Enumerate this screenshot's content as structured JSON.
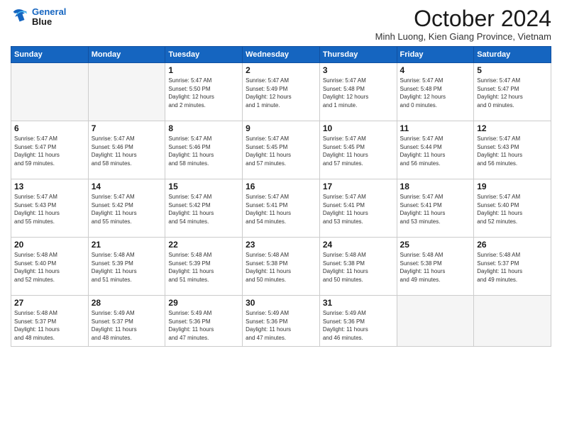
{
  "logo": {
    "line1": "General",
    "line2": "Blue"
  },
  "header": {
    "month": "October 2024",
    "location": "Minh Luong, Kien Giang Province, Vietnam"
  },
  "weekdays": [
    "Sunday",
    "Monday",
    "Tuesday",
    "Wednesday",
    "Thursday",
    "Friday",
    "Saturday"
  ],
  "weeks": [
    [
      {
        "day": "",
        "info": ""
      },
      {
        "day": "",
        "info": ""
      },
      {
        "day": "1",
        "info": "Sunrise: 5:47 AM\nSunset: 5:50 PM\nDaylight: 12 hours\nand 2 minutes."
      },
      {
        "day": "2",
        "info": "Sunrise: 5:47 AM\nSunset: 5:49 PM\nDaylight: 12 hours\nand 1 minute."
      },
      {
        "day": "3",
        "info": "Sunrise: 5:47 AM\nSunset: 5:48 PM\nDaylight: 12 hours\nand 1 minute."
      },
      {
        "day": "4",
        "info": "Sunrise: 5:47 AM\nSunset: 5:48 PM\nDaylight: 12 hours\nand 0 minutes."
      },
      {
        "day": "5",
        "info": "Sunrise: 5:47 AM\nSunset: 5:47 PM\nDaylight: 12 hours\nand 0 minutes."
      }
    ],
    [
      {
        "day": "6",
        "info": "Sunrise: 5:47 AM\nSunset: 5:47 PM\nDaylight: 11 hours\nand 59 minutes."
      },
      {
        "day": "7",
        "info": "Sunrise: 5:47 AM\nSunset: 5:46 PM\nDaylight: 11 hours\nand 58 minutes."
      },
      {
        "day": "8",
        "info": "Sunrise: 5:47 AM\nSunset: 5:46 PM\nDaylight: 11 hours\nand 58 minutes."
      },
      {
        "day": "9",
        "info": "Sunrise: 5:47 AM\nSunset: 5:45 PM\nDaylight: 11 hours\nand 57 minutes."
      },
      {
        "day": "10",
        "info": "Sunrise: 5:47 AM\nSunset: 5:45 PM\nDaylight: 11 hours\nand 57 minutes."
      },
      {
        "day": "11",
        "info": "Sunrise: 5:47 AM\nSunset: 5:44 PM\nDaylight: 11 hours\nand 56 minutes."
      },
      {
        "day": "12",
        "info": "Sunrise: 5:47 AM\nSunset: 5:43 PM\nDaylight: 11 hours\nand 56 minutes."
      }
    ],
    [
      {
        "day": "13",
        "info": "Sunrise: 5:47 AM\nSunset: 5:43 PM\nDaylight: 11 hours\nand 55 minutes."
      },
      {
        "day": "14",
        "info": "Sunrise: 5:47 AM\nSunset: 5:42 PM\nDaylight: 11 hours\nand 55 minutes."
      },
      {
        "day": "15",
        "info": "Sunrise: 5:47 AM\nSunset: 5:42 PM\nDaylight: 11 hours\nand 54 minutes."
      },
      {
        "day": "16",
        "info": "Sunrise: 5:47 AM\nSunset: 5:41 PM\nDaylight: 11 hours\nand 54 minutes."
      },
      {
        "day": "17",
        "info": "Sunrise: 5:47 AM\nSunset: 5:41 PM\nDaylight: 11 hours\nand 53 minutes."
      },
      {
        "day": "18",
        "info": "Sunrise: 5:47 AM\nSunset: 5:41 PM\nDaylight: 11 hours\nand 53 minutes."
      },
      {
        "day": "19",
        "info": "Sunrise: 5:47 AM\nSunset: 5:40 PM\nDaylight: 11 hours\nand 52 minutes."
      }
    ],
    [
      {
        "day": "20",
        "info": "Sunrise: 5:48 AM\nSunset: 5:40 PM\nDaylight: 11 hours\nand 52 minutes."
      },
      {
        "day": "21",
        "info": "Sunrise: 5:48 AM\nSunset: 5:39 PM\nDaylight: 11 hours\nand 51 minutes."
      },
      {
        "day": "22",
        "info": "Sunrise: 5:48 AM\nSunset: 5:39 PM\nDaylight: 11 hours\nand 51 minutes."
      },
      {
        "day": "23",
        "info": "Sunrise: 5:48 AM\nSunset: 5:38 PM\nDaylight: 11 hours\nand 50 minutes."
      },
      {
        "day": "24",
        "info": "Sunrise: 5:48 AM\nSunset: 5:38 PM\nDaylight: 11 hours\nand 50 minutes."
      },
      {
        "day": "25",
        "info": "Sunrise: 5:48 AM\nSunset: 5:38 PM\nDaylight: 11 hours\nand 49 minutes."
      },
      {
        "day": "26",
        "info": "Sunrise: 5:48 AM\nSunset: 5:37 PM\nDaylight: 11 hours\nand 49 minutes."
      }
    ],
    [
      {
        "day": "27",
        "info": "Sunrise: 5:48 AM\nSunset: 5:37 PM\nDaylight: 11 hours\nand 48 minutes."
      },
      {
        "day": "28",
        "info": "Sunrise: 5:49 AM\nSunset: 5:37 PM\nDaylight: 11 hours\nand 48 minutes."
      },
      {
        "day": "29",
        "info": "Sunrise: 5:49 AM\nSunset: 5:36 PM\nDaylight: 11 hours\nand 47 minutes."
      },
      {
        "day": "30",
        "info": "Sunrise: 5:49 AM\nSunset: 5:36 PM\nDaylight: 11 hours\nand 47 minutes."
      },
      {
        "day": "31",
        "info": "Sunrise: 5:49 AM\nSunset: 5:36 PM\nDaylight: 11 hours\nand 46 minutes."
      },
      {
        "day": "",
        "info": ""
      },
      {
        "day": "",
        "info": ""
      }
    ]
  ]
}
